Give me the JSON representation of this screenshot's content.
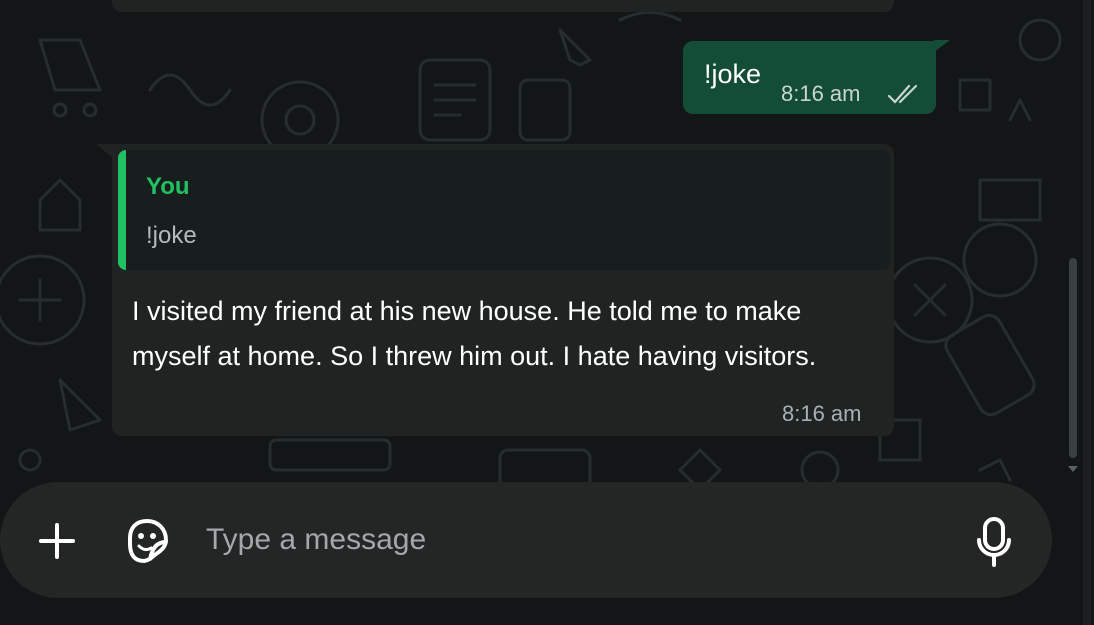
{
  "colors": {
    "background": "#121617",
    "outgoing_bubble": "#144d37",
    "incoming_bubble": "#1f2322",
    "quote_accent": "#21c063",
    "read_ticks": "#c8d6cf"
  },
  "outgoing_message": {
    "text": "!joke",
    "time": "8:16 am",
    "status_icon": "double-check-read-icon"
  },
  "incoming_message": {
    "quote": {
      "author": "You",
      "text": "!joke"
    },
    "text": "I visited my friend at his new house. He told me to make myself at home. So I threw him out. I hate having visitors.",
    "time": "8:16 am"
  },
  "composer": {
    "placeholder": "Type a message",
    "value": "",
    "attach_icon": "plus-icon",
    "sticker_icon": "sticker-icon",
    "voice_icon": "microphone-icon"
  }
}
